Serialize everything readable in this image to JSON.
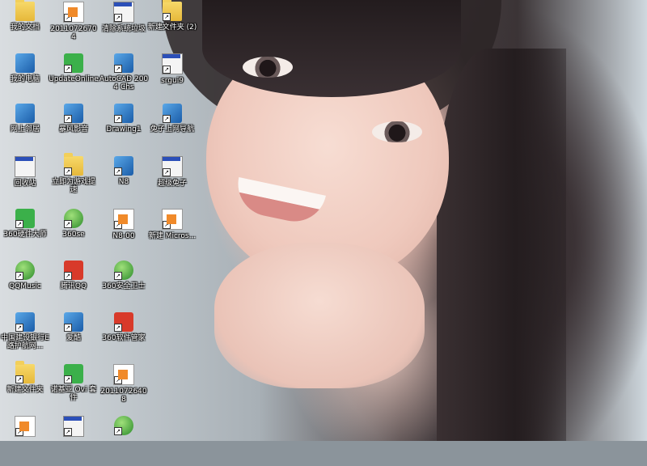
{
  "desktop": {
    "icons": [
      {
        "label": "我的文档",
        "icon": "my-documents-icon",
        "col": 0,
        "row": 0
      },
      {
        "label": "我的电脑",
        "icon": "my-computer-icon",
        "col": 0,
        "row": 1
      },
      {
        "label": "网上邻居",
        "icon": "network-places-icon",
        "col": 0,
        "row": 2
      },
      {
        "label": "回收站",
        "icon": "recycle-bin-icon",
        "col": 0,
        "row": 3
      },
      {
        "label": "360硬件大师",
        "icon": "360-hardware-icon",
        "col": 0,
        "row": 4
      },
      {
        "label": "QQMusic",
        "icon": "qqmusic-icon",
        "col": 0,
        "row": 5
      },
      {
        "label": "中国建设银行E路护航网...",
        "icon": "ccb-bank-icon",
        "col": 0,
        "row": 6
      },
      {
        "label": "新建文件夹",
        "icon": "folder-icon",
        "col": 0,
        "row": 7
      },
      {
        "label": "",
        "icon": "document-icon",
        "col": 0,
        "row": 8
      },
      {
        "label": "20110726704",
        "icon": "document-icon",
        "col": 1,
        "row": 0
      },
      {
        "label": "UpdateOnline",
        "icon": "update-online-icon",
        "col": 1,
        "row": 1
      },
      {
        "label": "暴风影音",
        "icon": "storm-player-icon",
        "col": 1,
        "row": 2
      },
      {
        "label": "立即为游戏提速",
        "icon": "game-boost-icon",
        "col": 1,
        "row": 3
      },
      {
        "label": "360se",
        "icon": "360-browser-icon",
        "col": 1,
        "row": 4
      },
      {
        "label": "腾讯QQ",
        "icon": "qq-penguin-icon",
        "col": 1,
        "row": 5
      },
      {
        "label": "爱酷",
        "icon": "iku-icon",
        "col": 1,
        "row": 6
      },
      {
        "label": "诺基亚 Ovi 套件",
        "icon": "nokia-ovi-icon",
        "col": 1,
        "row": 7
      },
      {
        "label": "",
        "icon": "batch-file-icon",
        "col": 1,
        "row": 8
      },
      {
        "label": "清除系统垃圾",
        "icon": "batch-file-icon",
        "col": 2,
        "row": 0
      },
      {
        "label": "AutoCAD 2004 Chs",
        "icon": "autocad-icon",
        "col": 2,
        "row": 1
      },
      {
        "label": "Drawing1",
        "icon": "dwg-file-icon",
        "col": 2,
        "row": 2
      },
      {
        "label": "N8",
        "icon": "dwg-file-icon",
        "col": 2,
        "row": 3
      },
      {
        "label": "N8-00",
        "icon": "document-icon",
        "col": 2,
        "row": 4
      },
      {
        "label": "360安全卫士",
        "icon": "360-safeguard-icon",
        "col": 2,
        "row": 5
      },
      {
        "label": "360软件管家",
        "icon": "360-software-manager-icon",
        "col": 2,
        "row": 6
      },
      {
        "label": "20110726408",
        "icon": "document-icon",
        "col": 2,
        "row": 7
      },
      {
        "label": "",
        "icon": "globe-icon",
        "col": 2,
        "row": 8
      },
      {
        "label": "新建文件夹 (2)",
        "icon": "folder-icon",
        "col": 3,
        "row": 0
      },
      {
        "label": "srgui9",
        "icon": "rabbit-icon",
        "col": 3,
        "row": 1
      },
      {
        "label": "兔子上网导航",
        "icon": "ie-browser-icon",
        "col": 3,
        "row": 2
      },
      {
        "label": "超级兔子",
        "icon": "rabbit-icon",
        "col": 3,
        "row": 3
      },
      {
        "label": "新建 Micros...",
        "icon": "word-document-icon",
        "col": 3,
        "row": 4
      }
    ]
  }
}
